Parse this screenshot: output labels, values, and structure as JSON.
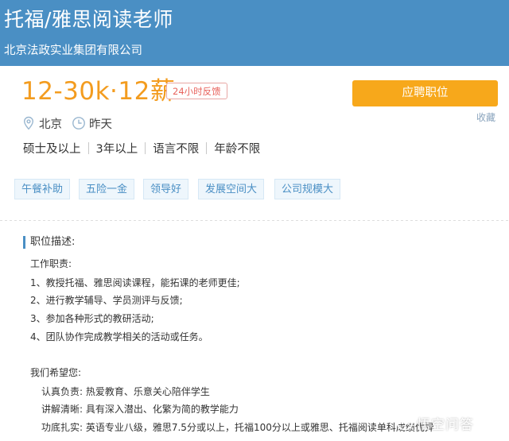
{
  "header": {
    "job_title": "托福/雅思阅读老师",
    "company": "北京法政实业集团有限公司"
  },
  "summary": {
    "salary": "12-30k·12薪",
    "feedback_badge": "24小时反馈",
    "apply_button": "应聘职位",
    "favorite": "收藏",
    "location": "北京",
    "posted": "昨天",
    "requirements": [
      "硕士及以上",
      "3年以上",
      "语言不限",
      "年龄不限"
    ],
    "perks": [
      "午餐补助",
      "五险一金",
      "领导好",
      "发展空间大",
      "公司规模大"
    ]
  },
  "description": {
    "heading": "职位描述:",
    "duties_title": "工作职责:",
    "duties": [
      "1、教授托福、雅思阅读课程，能拓课的老师更佳;",
      "2、进行教学辅导、学员测评与反馈;",
      "3、参加各种形式的教研活动;",
      "4、团队协作完成教学相关的活动或任务。"
    ],
    "hope_title": "我们希望您:",
    "hopes": [
      "认真负责:  热爱教育、乐意关心陪伴学生",
      "讲解清晰:  具有深入潜出、化繁为简的教学能力",
      "功底扎实:  英语专业八级，雅思7.5分或以上，托福100分以上或雅思、托福阅读单科成绩优异"
    ]
  },
  "watermark": "悟空问答",
  "colors": {
    "header_bg": "#4a8fc4",
    "salary": "#f39c1f",
    "apply_bg": "#f7a81b",
    "tag_text": "#4a8fc4",
    "badge": "#e8635d"
  }
}
